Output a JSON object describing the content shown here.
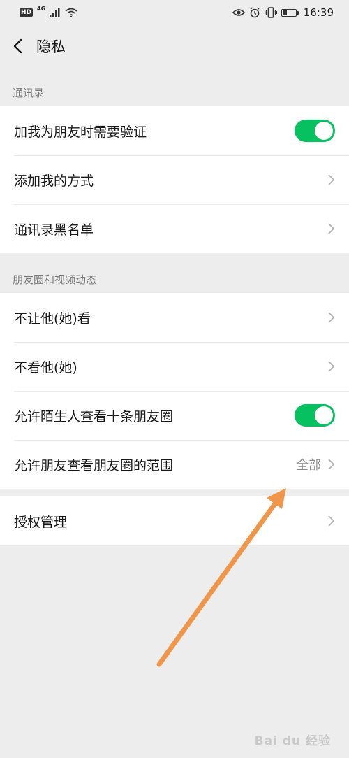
{
  "status_bar": {
    "hd": "HD",
    "network": "4G",
    "time": "16:39",
    "icons": [
      "signal-icon",
      "wifi-icon",
      "eye-icon",
      "alarm-icon",
      "vibrate-icon",
      "battery-icon"
    ]
  },
  "header": {
    "title": "隐私"
  },
  "sections": {
    "contacts": {
      "title": "通讯录",
      "rows": {
        "verify": {
          "label": "加我为朋友时需要验证",
          "toggle_on": true
        },
        "add_methods": {
          "label": "添加我的方式"
        },
        "blacklist": {
          "label": "通讯录黑名单"
        }
      }
    },
    "moments": {
      "title": "朋友圈和视频动态",
      "rows": {
        "hide_from": {
          "label": "不让他(她)看"
        },
        "dont_see": {
          "label": "不看他(她)"
        },
        "strangers": {
          "label": "允许陌生人查看十条朋友圈",
          "toggle_on": true
        },
        "range": {
          "label": "允许朋友查看朋友圈的范围",
          "value": "全部"
        }
      }
    },
    "auth": {
      "rows": {
        "auth_manage": {
          "label": "授权管理"
        }
      }
    }
  },
  "watermark": "Bai du 经验",
  "colors": {
    "toggle_on": "#07c160",
    "background": "#ededed",
    "annotation_arrow": "#f0964a"
  }
}
